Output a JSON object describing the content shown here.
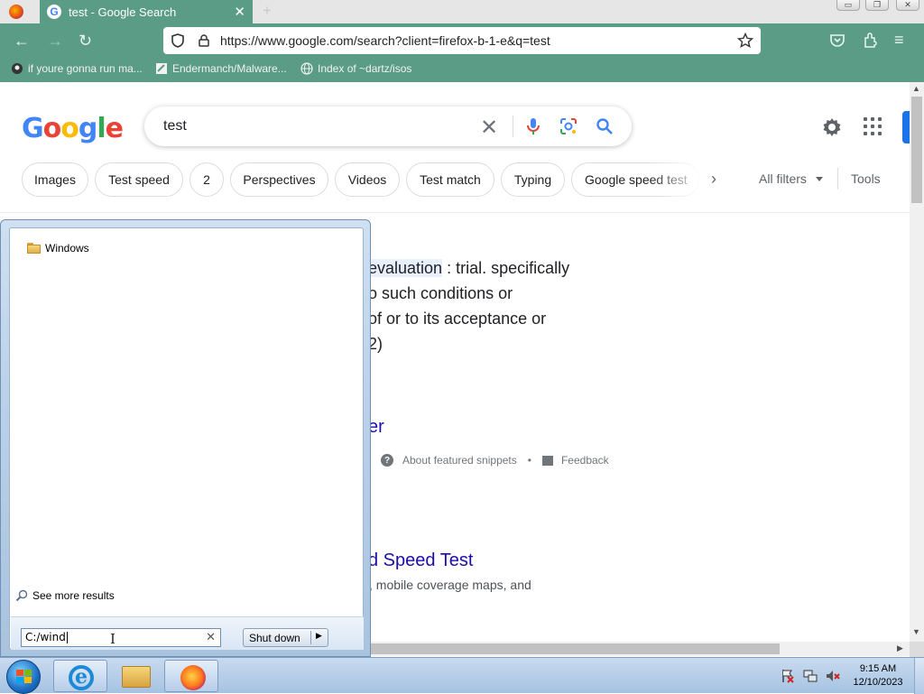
{
  "browser": {
    "tab": {
      "title": "test - Google Search"
    },
    "url": "https://www.google.com/search?client=firefox-b-1-e&q=test",
    "bookmarks": [
      {
        "label": "if youre gonna run ma..."
      },
      {
        "label": "Endermanch/Malware..."
      },
      {
        "label": "Index of ~dartz/isos"
      }
    ]
  },
  "google": {
    "logo_text": "Google",
    "query": "test",
    "chips": [
      "Images",
      "Test speed",
      "2",
      "Perspectives",
      "Videos",
      "Test match",
      "Typing",
      "Google speed test"
    ],
    "all_filters": "All filters",
    "tools": "Tools",
    "snippet": {
      "highlight": "evaluation",
      "line1_rest": " : trial. specifically",
      "line2": "o such conditions or",
      "line3": "of or to its acceptance or",
      "line4": "2)",
      "link": "er",
      "about": "About featured snippets",
      "separator": "•",
      "feedback": "Feedback"
    },
    "result2": {
      "title": "d Speed Test",
      "desc": ", mobile coverage maps, and"
    }
  },
  "start_menu": {
    "result_item": "Windows",
    "see_more": "See more results",
    "search_value": "C:/wind",
    "shutdown_label": "Shut down"
  },
  "taskbar": {
    "time": "9:15 AM",
    "date": "12/10/2023"
  },
  "colors": {
    "firefox_theme": "#5a9c86",
    "google_link": "#1a0dab",
    "google_blue": "#4285f4"
  }
}
